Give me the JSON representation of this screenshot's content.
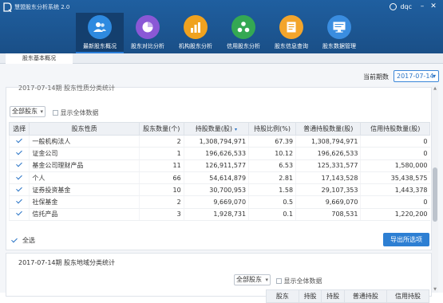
{
  "app": {
    "title": "慧盟股东分析系统 2.0",
    "user": "dqc"
  },
  "nav": [
    {
      "label": "最新股东概况",
      "color": "#2e8ae0",
      "icon": "people-icon"
    },
    {
      "label": "股东对比分析",
      "color": "#8a58d6",
      "icon": "pie-icon"
    },
    {
      "label": "机构股东分析",
      "color": "#f0a21f",
      "icon": "bar-chart-icon"
    },
    {
      "label": "信用股东分析",
      "color": "#34a853",
      "icon": "nodes-icon"
    },
    {
      "label": "股东信息查询",
      "color": "#f3a52c",
      "icon": "document-icon"
    },
    {
      "label": "股东数据管理",
      "color": "#3a8de0",
      "icon": "monitor-icon"
    }
  ],
  "tab": {
    "label": "股东基本概况"
  },
  "period": {
    "label": "当前期数",
    "value": "2017-07-14"
  },
  "section1": {
    "title": "2017-07-14期 股东性质分类统计",
    "filter": "全部股东",
    "show_all": "显示全体数据",
    "columns": [
      "选择",
      "股东性质",
      "股东数量(个)",
      "持股数量(股)",
      "持股比例(%)",
      "普通持股数量(股)",
      "信用持股数量(股)"
    ],
    "rows": [
      [
        "一般机构法人",
        "2",
        "1,308,794,971",
        "67.39",
        "1,308,794,971",
        "0"
      ],
      [
        "证金公司",
        "1",
        "196,626,533",
        "10.12",
        "196,626,533",
        "0"
      ],
      [
        "基金公司理财产品",
        "11",
        "126,911,577",
        "6.53",
        "125,331,577",
        "1,580,000"
      ],
      [
        "个人",
        "66",
        "54,614,879",
        "2.81",
        "17,143,528",
        "35,438,575"
      ],
      [
        "证券投资基金",
        "10",
        "30,700,953",
        "1.58",
        "29,107,353",
        "1,443,378"
      ],
      [
        "社保基金",
        "2",
        "9,669,070",
        "0.5",
        "9,669,070",
        "0"
      ],
      [
        "信托产品",
        "3",
        "1,928,731",
        "0.1",
        "708,531",
        "1,220,200"
      ]
    ],
    "select_all": "全选",
    "export": "导出所选项"
  },
  "section2": {
    "title": "2017-07-14期 股东地域分类统计",
    "filter": "全部股东",
    "show_all": "显示全体数据",
    "columns": [
      "股东",
      "持股",
      "持股",
      "普通持股",
      "信用持股"
    ]
  }
}
